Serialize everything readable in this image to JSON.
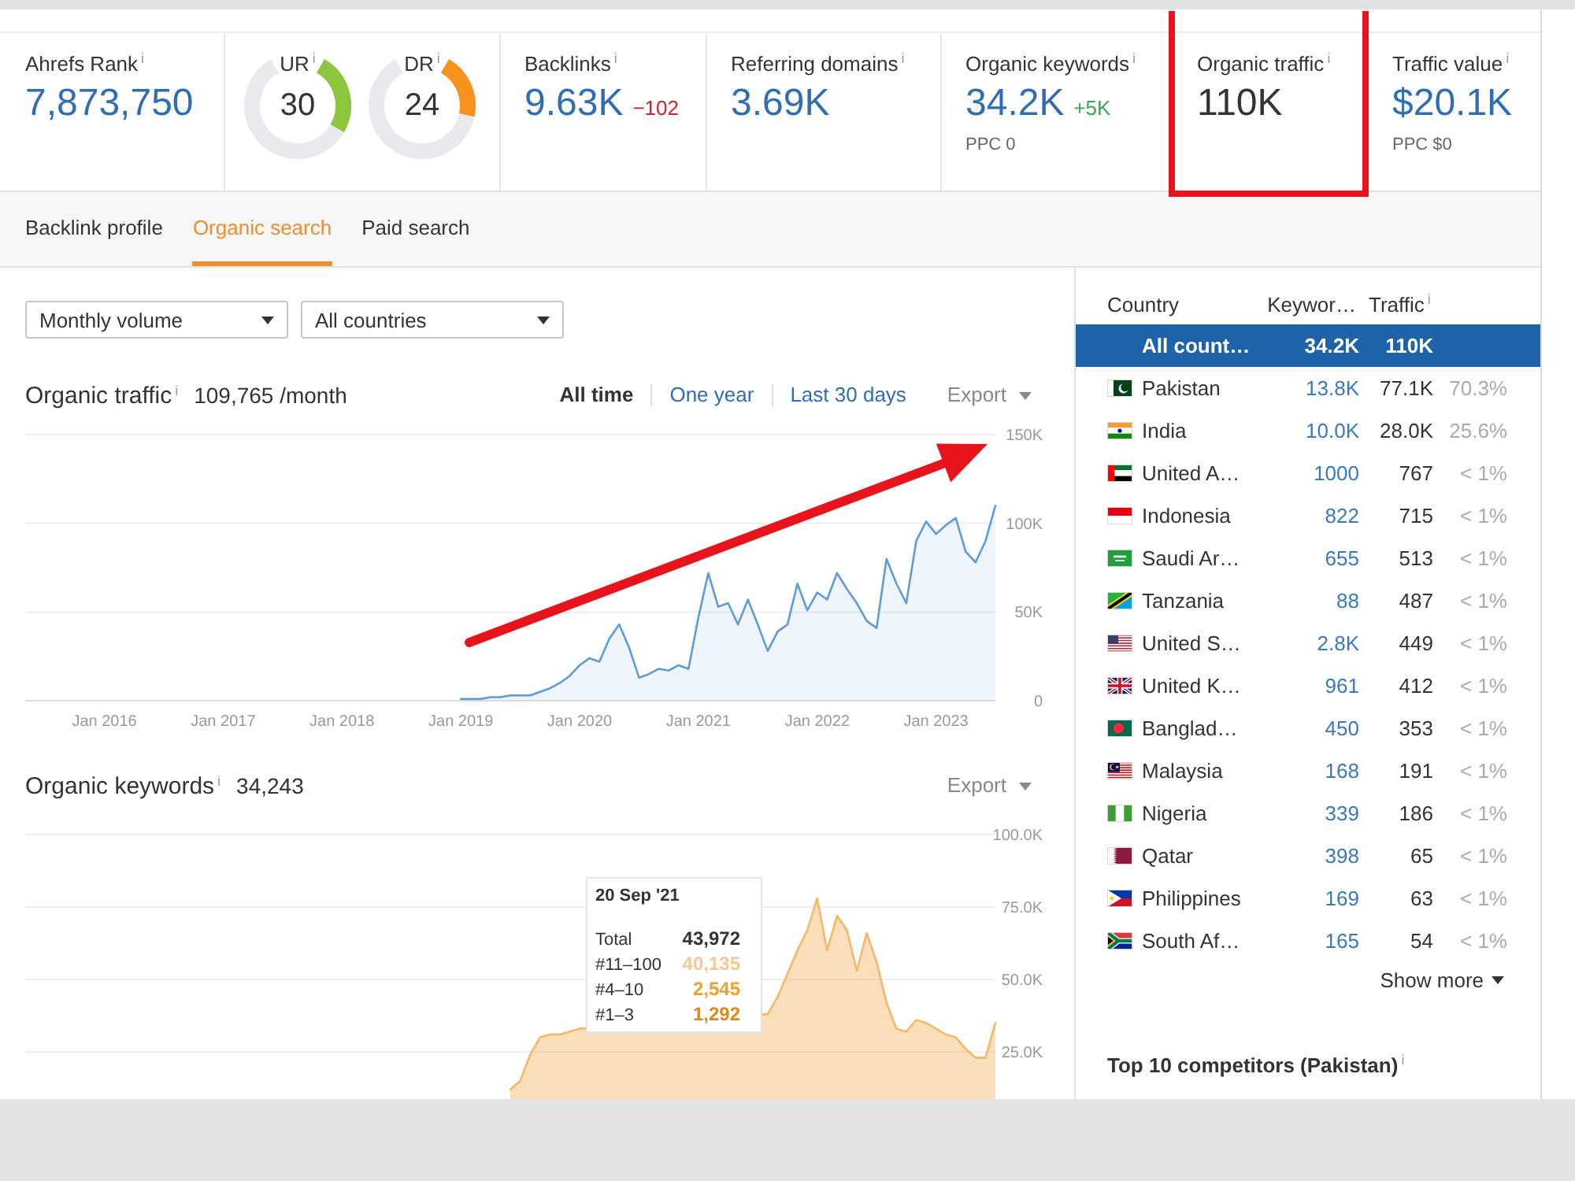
{
  "metrics": [
    {
      "kind": "number",
      "label": "Ahrefs Rank$^{i}$",
      "value": "7,873,750",
      "link": true,
      "highlighted": false
    },
    {
      "kind": "gauges",
      "highlighted": false,
      "gauges": [
        {
          "label": "UR$^{i}$",
          "value": "30",
          "level": 0.3,
          "color": "#8cc63e"
        },
        {
          "label": "DR$^{i}$",
          "value": "24",
          "level": 0.24,
          "color": "#f7931d"
        }
      ]
    },
    {
      "kind": "number",
      "label": "Backlinks$^{i}$",
      "value": "9.63K",
      "link": true,
      "highlighted": false,
      "change": {
        "text": "−102",
        "color": "#d0222c"
      }
    },
    {
      "kind": "number",
      "label": "Referring domains$^{i}$",
      "value": "3.69K",
      "link": true,
      "highlighted": false
    },
    {
      "kind": "number",
      "label": "Organic keywords$^{i}$",
      "value": "34.2K",
      "link": true,
      "highlighted": false,
      "change": {
        "text": "+5K",
        "color": "#35a853"
      },
      "note": "PPC 0"
    },
    {
      "kind": "number",
      "label": "Organic traffic$^{i}$",
      "value": "110K",
      "link": false,
      "highlighted": true
    },
    {
      "kind": "number",
      "label": "Traffic value$^{i}$",
      "value": "$20.1K",
      "link": true,
      "highlighted": false,
      "note": "PPC $0"
    }
  ],
  "tabs": [
    {
      "label": "Backlink profile",
      "selected": false
    },
    {
      "label": "Organic search",
      "selected": true
    },
    {
      "label": "Paid search",
      "selected": false
    }
  ],
  "filters": [
    {
      "value": "Monthly volume"
    },
    {
      "value": "All countries"
    }
  ],
  "traffic_chart": {
    "value": "109,765 /month",
    "arrow": true,
    "ranges": [
      {
        "label": "All time",
        "selected": true
      },
      {
        "label": "One year",
        "selected": false
      },
      {
        "label": "Last 30 days",
        "selected": false
      }
    ],
    "export": "Export",
    "chart_data": {
      "type": "area",
      "title": "Organic traffic$^{i}$",
      "grid": true,
      "categories": [
        null,
        null,
        null,
        null,
        null,
        null,
        null,
        null,
        "Jan 2016",
        null,
        null,
        null,
        null,
        null,
        null,
        null,
        null,
        null,
        null,
        null,
        "Jan 2017",
        null,
        null,
        null,
        null,
        null,
        null,
        null,
        null,
        null,
        null,
        null,
        "Jan 2018",
        null,
        null,
        null,
        null,
        null,
        null,
        null,
        null,
        null,
        null,
        null,
        "Jan 2019",
        null,
        null,
        null,
        null,
        null,
        null,
        null,
        null,
        null,
        null,
        null,
        "Jan 2020",
        null,
        null,
        null,
        null,
        null,
        null,
        null,
        null,
        null,
        null,
        null,
        "Jan 2021",
        null,
        null,
        null,
        null,
        null,
        null,
        null,
        null,
        null,
        null,
        null,
        "Jan 2022",
        null,
        null,
        null,
        null,
        null,
        null,
        null,
        null,
        null,
        null,
        null,
        "Jan 2023",
        null,
        null,
        null,
        null,
        null,
        null
      ],
      "series": [
        {
          "color": "#5d9cd8",
          "values": [
            null,
            null,
            null,
            null,
            null,
            null,
            null,
            null,
            null,
            null,
            null,
            null,
            null,
            null,
            null,
            null,
            null,
            null,
            null,
            null,
            null,
            null,
            null,
            null,
            null,
            null,
            null,
            null,
            null,
            null,
            null,
            null,
            null,
            null,
            null,
            null,
            null,
            null,
            null,
            null,
            null,
            null,
            null,
            null,
            1000,
            1000,
            1000,
            2000,
            2000,
            3000,
            3000,
            3000,
            5000,
            7000,
            10000,
            14000,
            20000,
            24000,
            22000,
            35000,
            43000,
            30000,
            13000,
            15000,
            18000,
            17000,
            20000,
            18000,
            47000,
            72000,
            53000,
            55000,
            43000,
            57000,
            43000,
            28000,
            39000,
            43000,
            66000,
            51000,
            61000,
            57000,
            72000,
            63000,
            55000,
            45000,
            41000,
            80000,
            66000,
            55000,
            90000,
            101000,
            94000,
            99000,
            103000,
            84000,
            78000,
            90000,
            110000
          ]
        }
      ],
      "ylim": [
        0,
        150000
      ],
      "yticks": [
        {
          "value": 0,
          "label": "0"
        },
        {
          "value": 50000,
          "label": "50K"
        },
        {
          "value": 100000,
          "label": "100K"
        },
        {
          "value": 150000,
          "label": "150K"
        }
      ]
    }
  },
  "keywords_chart": {
    "value": "34,243",
    "export": "Export",
    "chart_data": {
      "type": "area",
      "title": "Organic keywords$^{i}$",
      "grid": true,
      "categories": [
        null,
        null,
        null,
        null,
        null,
        null,
        null,
        null,
        null,
        null,
        null,
        null,
        null,
        null,
        null,
        null,
        null,
        null,
        null,
        null,
        null,
        null,
        null,
        null,
        null,
        null,
        null,
        null,
        null,
        null,
        null,
        null,
        null,
        null,
        null,
        null,
        null,
        null,
        null,
        null,
        null,
        null,
        null,
        null,
        null,
        null,
        null,
        null,
        null,
        null,
        null,
        null,
        null,
        null,
        null,
        null,
        null,
        null,
        null,
        null,
        null,
        null,
        null,
        null,
        null,
        null,
        null,
        null,
        null,
        null,
        null,
        null,
        null,
        null,
        null,
        null,
        null,
        null,
        null,
        null,
        null,
        null,
        null,
        null,
        null,
        null,
        null,
        null,
        null,
        null,
        null,
        null,
        null,
        null,
        null,
        null,
        null,
        null,
        null
      ],
      "series": [
        {
          "color": "#f6b868",
          "values": [
            null,
            null,
            null,
            null,
            null,
            null,
            null,
            null,
            null,
            null,
            null,
            null,
            null,
            null,
            null,
            null,
            null,
            null,
            null,
            null,
            null,
            null,
            null,
            null,
            null,
            null,
            null,
            null,
            null,
            null,
            null,
            null,
            null,
            null,
            null,
            null,
            null,
            null,
            null,
            null,
            null,
            null,
            null,
            null,
            null,
            null,
            null,
            null,
            null,
            12000,
            15000,
            24000,
            30000,
            31000,
            31000,
            32000,
            33000,
            null,
            null,
            null,
            null,
            null,
            null,
            null,
            null,
            null,
            null,
            null,
            null,
            null,
            null,
            null,
            null,
            null,
            null,
            38000,
            44000,
            52000,
            60000,
            67000,
            78000,
            60000,
            72000,
            67000,
            53000,
            66000,
            56000,
            42000,
            33000,
            32000,
            36000,
            35000,
            33000,
            31000,
            30000,
            26000,
            23000,
            23000,
            35000
          ]
        }
      ],
      "ylim": [
        0,
        100000
      ],
      "yticks": [
        {
          "value": 25000,
          "label": "25.0K"
        },
        {
          "value": 50000,
          "label": "50.0K"
        },
        {
          "value": 75000,
          "label": "75.0K"
        },
        {
          "value": 100000,
          "label": "100.0K"
        }
      ]
    },
    "tooltip": {
      "date": "20 Sep '21",
      "rows": [
        {
          "label": "Total",
          "value": "43,972",
          "color": "#333333"
        },
        {
          "label": "#11–100",
          "value": "40,135",
          "color": "#f5c794"
        },
        {
          "label": "#4–10",
          "value": "2,545",
          "color": "#f0a02c"
        },
        {
          "label": "#1–3",
          "value": "1,292",
          "color": "#d98b1e"
        }
      ]
    }
  },
  "countries": {
    "columns": [
      "Country",
      "Keywor…",
      "Traffic$^{i}$"
    ],
    "rows": [
      {
        "kind": "total",
        "name": "All count…",
        "keywords": "34.2K",
        "traffic": "110K",
        "selected": true
      },
      {
        "kind": "country",
        "name": "Pakistan",
        "keywords": "13.8K",
        "traffic": "77.1K",
        "share": "70.3%",
        "selected": false
      },
      {
        "kind": "country",
        "name": "India",
        "keywords": "10.0K",
        "traffic": "28.0K",
        "share": "25.6%",
        "selected": false
      },
      {
        "kind": "country",
        "name": "United A…",
        "keywords": "1000",
        "traffic": "767",
        "share": "< 1%",
        "selected": false
      },
      {
        "kind": "country",
        "name": "Indonesia",
        "keywords": "822",
        "traffic": "715",
        "share": "< 1%",
        "selected": false
      },
      {
        "kind": "country",
        "name": "Saudi Ar…",
        "keywords": "655",
        "traffic": "513",
        "share": "< 1%",
        "selected": false
      },
      {
        "kind": "country",
        "name": "Tanzania",
        "keywords": "88",
        "traffic": "487",
        "share": "< 1%",
        "selected": false
      },
      {
        "kind": "country",
        "name": "United S…",
        "keywords": "2.8K",
        "traffic": "449",
        "share": "< 1%",
        "selected": false
      },
      {
        "kind": "country",
        "name": "United K…",
        "keywords": "961",
        "traffic": "412",
        "share": "< 1%",
        "selected": false
      },
      {
        "kind": "country",
        "name": "Banglad…",
        "keywords": "450",
        "traffic": "353",
        "share": "< 1%",
        "selected": false
      },
      {
        "kind": "country",
        "name": "Malaysia",
        "keywords": "168",
        "traffic": "191",
        "share": "< 1%",
        "selected": false
      },
      {
        "kind": "country",
        "name": "Nigeria",
        "keywords": "339",
        "traffic": "186",
        "share": "< 1%",
        "selected": false
      },
      {
        "kind": "country",
        "name": "Qatar",
        "keywords": "398",
        "traffic": "65",
        "share": "< 1%",
        "selected": false
      },
      {
        "kind": "country",
        "name": "Philippines",
        "keywords": "169",
        "traffic": "63",
        "share": "< 1%",
        "selected": false
      },
      {
        "kind": "country",
        "name": "South Af…",
        "keywords": "165",
        "traffic": "54",
        "share": "< 1%",
        "selected": false
      }
    ],
    "show_more": "Show more"
  },
  "competitors": {
    "title": "Top 10 competitors (Pakistan)$^{i}$"
  }
}
